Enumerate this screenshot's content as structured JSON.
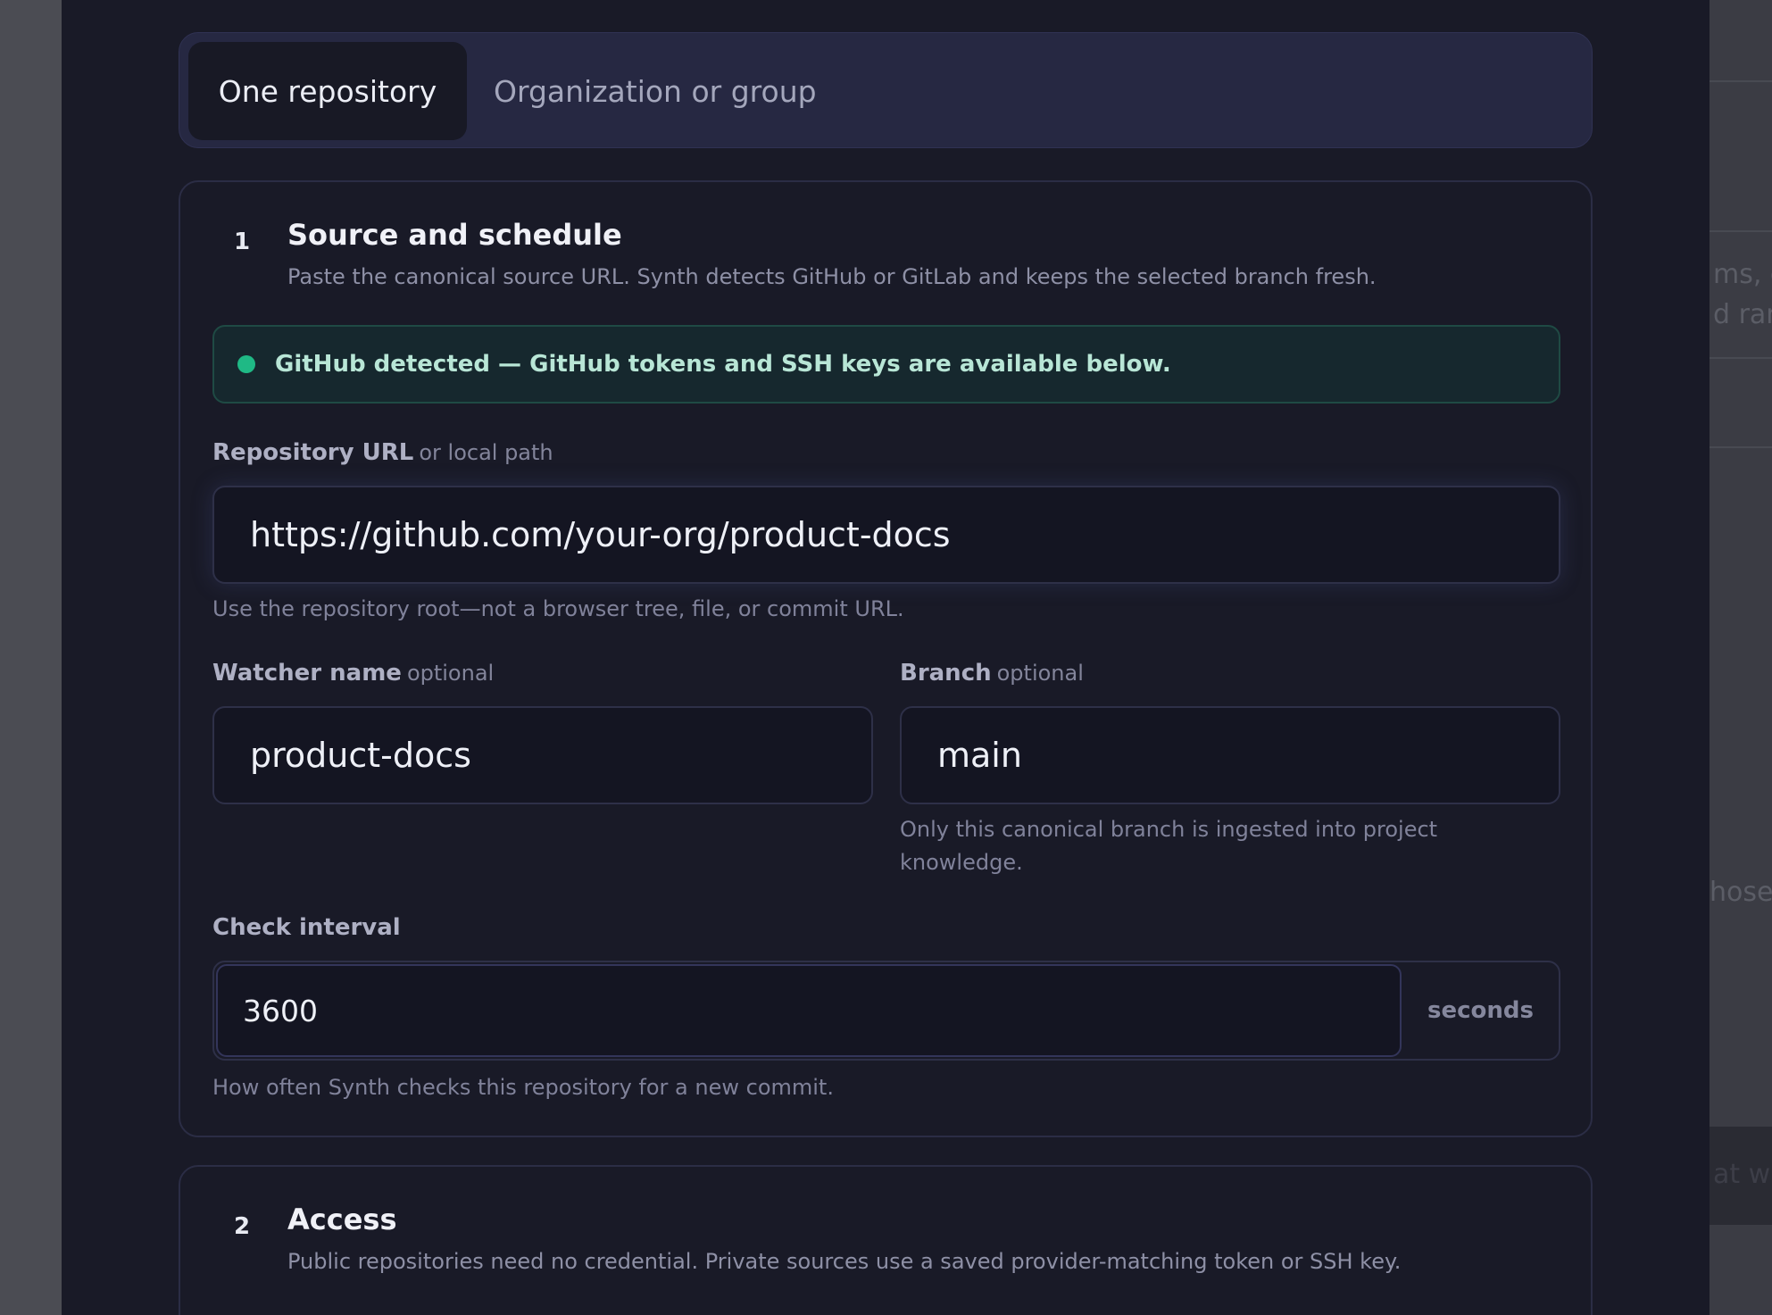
{
  "tabs": [
    {
      "label": "One repository",
      "active": true
    },
    {
      "label": "Organization or group",
      "active": false
    }
  ],
  "section1": {
    "number": "1",
    "title": "Source and schedule",
    "description": "Paste the canonical source URL. Synth detects GitHub or GitLab and keeps the selected branch fresh.",
    "detection": {
      "status_color": "#1fb985",
      "text": "GitHub detected — GitHub tokens and SSH keys are available below."
    },
    "repo_url": {
      "label": "Repository URL",
      "label_suffix": "or local path",
      "value": "https://github.com/your-org/product-docs",
      "help": "Use the repository root—not a browser tree, file, or commit URL."
    },
    "watcher_name": {
      "label": "Watcher name",
      "label_suffix": "optional",
      "value": "product-docs"
    },
    "branch": {
      "label": "Branch",
      "label_suffix": "optional",
      "value": "main",
      "help_line1": "Only this canonical branch is ingested into project",
      "help_line2": "knowledge."
    },
    "check_interval": {
      "label": "Check interval",
      "value": "3600",
      "unit": "seconds",
      "help": "How often Synth checks this repository for a new commit."
    }
  },
  "section2": {
    "number": "2",
    "title": "Access",
    "description": "Public repositories need no credential. Private sources use a saved provider-matching token or SSH key."
  },
  "background_page": {
    "text_1": "ms, d",
    "text_2": "d ran",
    "text_3": "hose",
    "text_4": "at w"
  }
}
